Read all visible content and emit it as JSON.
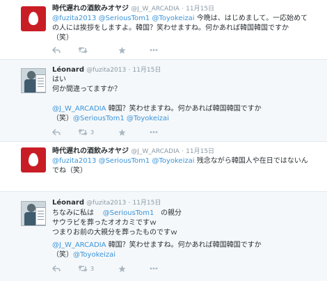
{
  "colors": {
    "link": "#3b94d9",
    "meta": "#8899a6",
    "icon": "#aab8c2",
    "text": "#292f33"
  },
  "tweets": [
    {
      "author": "時代遅れの酒飲みオヤジ",
      "handle": "@J_W_ARCADIA",
      "dot": "·",
      "date": "11月15日",
      "avatar": "red-egg-avatar",
      "line1_mentions": "@fuzita2013 @SeriousTom1 @Toyokeizai",
      "line1_text": " 今晩は、はじめまして。一応始めて",
      "line2": "の人には挨拶をしますよ。韓国？笑わせますね。何かあれば韓国韓国ですか",
      "line3": "（笑）"
    },
    {
      "author": "Léonard",
      "handle": "@fuzita2013",
      "dot": "·",
      "date": "11月15日",
      "avatar": "man-with-newspaper-avatar",
      "line1": "はい",
      "line2": "何か間違ってますか？",
      "line3_mention": "@J_W_ARCADIA",
      "line3_text": " 韓国？笑わせますね。何かあれば韓国韓国ですか",
      "line4_text": "（笑）",
      "line4_mentions": "@SeriousTom1 @Toyokeizai",
      "retweets": "3"
    },
    {
      "author": "時代遅れの酒飲みオヤジ",
      "handle": "@J_W_ARCADIA",
      "dot": "·",
      "date": "11月15日",
      "avatar": "red-egg-avatar",
      "line1_mentions": "@fuzita2013 @SeriousTom1 @Toyokeizai",
      "line1_text": " 残念ながら韓国人や在日ではないん",
      "line2": "でね（笑）"
    },
    {
      "author": "Léonard",
      "handle": "@fuzita2013",
      "dot": "·",
      "date": "11月15日",
      "avatar": "man-with-newspaper-avatar",
      "line1_a": "ちなみに私は",
      "line1_mention": "@SeriousTom1",
      "line1_b": "の親分",
      "line2": "サウラビを葬ったオオカミですｗ",
      "line3": "つまりお前の大親分を葬ったものですｗ",
      "line4_mention": "@J_W_ARCADIA",
      "line4_text": " 韓国？笑わせますね。何かあれば韓国韓国ですか",
      "line5_text": "（笑）",
      "line5_mention": "@Toyokeizai",
      "retweets": "3"
    }
  ]
}
